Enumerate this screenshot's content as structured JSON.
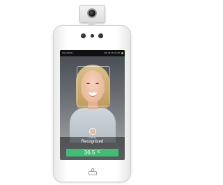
{
  "status_bar": {
    "left_text": "SN:FA3830",
    "right_text": "FRI 05:38:16 PM"
  },
  "recognition": {
    "name": "Kathy",
    "status": "Recognized"
  },
  "temperature": {
    "value": "36.5",
    "unit": "°C"
  },
  "colors": {
    "temperature_ok": "#3fbf73",
    "device_body": "#ffffff",
    "screen_bg": "#0a0a0a"
  },
  "icons": {
    "thermal_camera": "thermal-camera-icon",
    "home_button": "touch-key-icon"
  }
}
